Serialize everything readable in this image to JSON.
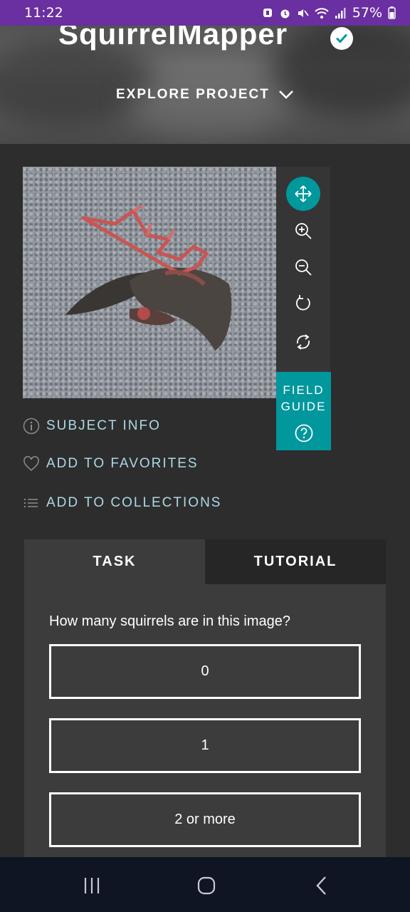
{
  "status_bar": {
    "time": "11:22",
    "battery": "57%"
  },
  "header": {
    "project_title": "SquirrelMapper",
    "explore_label": "EXPLORE PROJECT"
  },
  "toolbar": {
    "tools": [
      "move-icon",
      "zoom-in-icon",
      "zoom-out-icon",
      "rotate-icon",
      "reset-icon"
    ],
    "field_guide_line1": "FIELD",
    "field_guide_line2": "GUIDE"
  },
  "subject_links": {
    "subject_info": "SUBJECT INFO",
    "add_favorites": "ADD TO FAVORITES",
    "add_collections": "ADD TO COLLECTIONS"
  },
  "tabs": {
    "task": "TASK",
    "tutorial": "TUTORIAL"
  },
  "task": {
    "question": "How many squirrels are in this image?",
    "answers": [
      "0",
      "1",
      "2 or more"
    ]
  },
  "colors": {
    "accent": "#00979d",
    "link": "#add8e6",
    "status_bar": "#6a2fa0",
    "nav_bar": "#101524"
  }
}
